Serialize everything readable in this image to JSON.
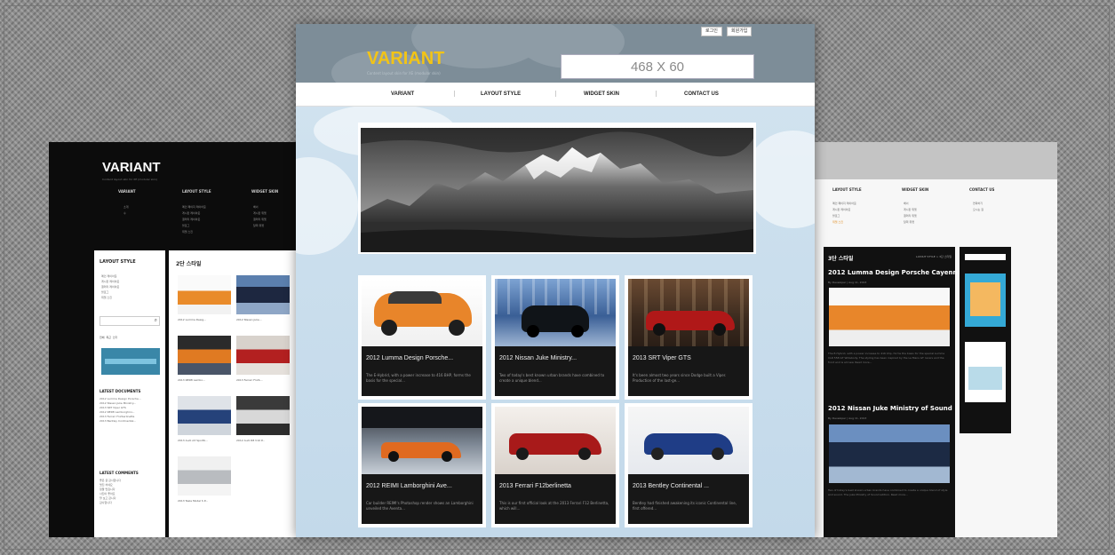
{
  "left_preview": {
    "logo": "VARIANT",
    "tagline": "Content layout skin for XE (modular skin)",
    "nav": [
      "VARIANT",
      "LAYOUT STYLE",
      "WIDGET SKIN"
    ],
    "nav_sub": [
      [
        "소개",
        "수"
      ],
      [
        "메인 페이지 레이아웃",
        "게시판 레이아웃",
        "갤러리 레이아웃",
        "블로그",
        "위젯 스킨"
      ],
      [
        "배너",
        "게시판 위젯",
        "갤러리 위젯",
        "달력 위젯"
      ]
    ],
    "sidebar": {
      "heading": "LAYOUT STYLE",
      "items": [
        "메인 레이아웃",
        "게시판 레이아웃",
        "갤러리 레이아웃",
        "블로그",
        "위젯 스킨"
      ],
      "tabs": [
        "전체",
        "최근",
        "인기"
      ],
      "latest_documents_heading": "LATEST DOCUMENTS",
      "latest_documents": [
        "2012 Lumma Design Porsche...",
        "2012 Nissan Juke Ministry...",
        "2013 SRT Viper GTS",
        "2012 REIMI Lamborghini...",
        "2013 Ferrari F12berlinetta",
        "2013 Bentley Continental..."
      ],
      "latest_comments_heading": "LATEST COMMENTS",
      "latest_comments": [
        "좋은 글 감사합니다",
        "멋진 차네요",
        "정말 멋집니다",
        "사진이 좋아요",
        "잘 보고 갑니다",
        "감사합니다"
      ]
    },
    "main_heading": "2단 스타일",
    "thumb_captions": [
      "2012 Lumma Desig...",
      "2012 Nissan Juke...",
      "2013 REIMI Lambo...",
      "2013 Ferrari F12b...",
      "2013 Audi A3 Sportb...",
      "2012 Audi R8 V10 P...",
      "2013 Tesla Model S P..."
    ]
  },
  "right_preview": {
    "nav": [
      "LAYOUT STYLE",
      "WIDGET SKIN",
      "CONTACT US"
    ],
    "nav_sub": [
      [
        "메인 페이지 레이아웃",
        "게시판 레이아웃",
        "블로그",
        "위젯 스킨"
      ],
      [
        "배너",
        "게시판 위젯",
        "갤러리 위젯",
        "달력 위젯"
      ],
      [
        "연락하기",
        "오시는 길"
      ]
    ],
    "main_heading": "3단 스타일",
    "main_breadcrumb": "LAYOUT STYLE > 3단 스타일",
    "posts": [
      {
        "title": "2012 Lumma Design Porsche Cayenne",
        "meta": "By Developer | Aug 11, 2013",
        "text": "The E-Hybrid, with a power increase to 416 bhp, forms the basis for the special Lumma CLR 558 GT Widebody. The styling has been inspired by the Le Mans GT racers and the front end is all new. Read more..."
      },
      {
        "title": "2012 Nissan Juke Ministry of Sound",
        "meta": "By Developer | Aug 11, 2013",
        "text": "Two of today's best known urban brands have combined to create a unique blend of style and sound. The Juke Ministry of Sound edition. Read more..."
      }
    ]
  },
  "center_preview": {
    "top_buttons": [
      "로그인",
      "회원가입"
    ],
    "logo": "VARIANT",
    "tagline": "Content layout skin for XE (modular skin)",
    "ad_placeholder": "468 X 60",
    "nav": [
      "VARIANT",
      "LAYOUT STYLE",
      "WIDGET SKIN",
      "CONTACT US"
    ],
    "slider": {
      "prev": "‹",
      "next": "›"
    },
    "cards": [
      {
        "title": "2012 Lumma Design Porsche...",
        "desc": "The E-Hybrid, with a power increase to 416 BHP, forms the basis for the special..."
      },
      {
        "title": "2012 Nissan Juke Ministry...",
        "desc": "Two of today's best known urban brands have combined to create a unique blend..."
      },
      {
        "title": "2013 SRT Viper GTS",
        "desc": "It's been almost two years since Dodge built a Viper. Production of the last-ge..."
      },
      {
        "title": "2012 REIMI Lamborghini Ave...",
        "desc": "Car builder REIMI's Photoshop render shows an Lamborghini unveiled the Aventa..."
      },
      {
        "title": "2013 Ferrari F12berlinetta",
        "desc": "This is our first official look at the 2013 Ferrari F12 Berlinetta, which will..."
      },
      {
        "title": "2013 Bentley Continental ...",
        "desc": "Bentley had finished awakening its iconic Continental line, first offered..."
      }
    ]
  }
}
